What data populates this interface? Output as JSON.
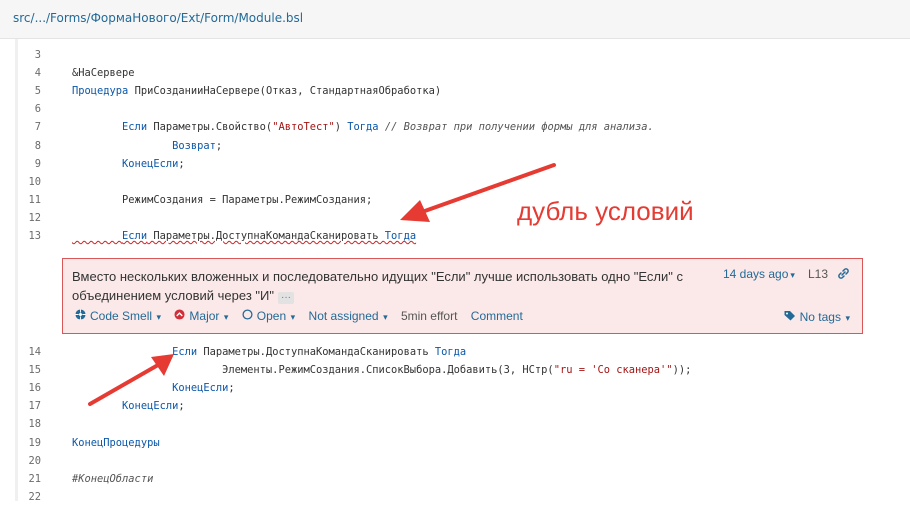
{
  "breadcrumb": {
    "path": "src/.../Forms/ФормаНового/Ext/Form/Module.bsl"
  },
  "code_top": [
    {
      "ln": "3"
    },
    {
      "ln": "4",
      "t": [
        {
          "x": "&НаСервере",
          "c": ""
        }
      ]
    },
    {
      "ln": "5",
      "t": [
        {
          "x": "Процедура",
          "c": "kw"
        },
        {
          "x": " ПриСозданииНаСервере(Отказ, СтандартнаяОбработка)",
          "c": ""
        }
      ]
    },
    {
      "ln": "6"
    },
    {
      "ln": "7",
      "t": [
        {
          "x": "        ",
          "c": ""
        },
        {
          "x": "Если",
          "c": "kw"
        },
        {
          "x": " Параметры.Свойство(",
          "c": ""
        },
        {
          "x": "\"АвтоТест\"",
          "c": "str"
        },
        {
          "x": ") ",
          "c": ""
        },
        {
          "x": "Тогда",
          "c": "kw"
        },
        {
          "x": " // Возврат при получении формы для анализа.",
          "c": "cm"
        }
      ]
    },
    {
      "ln": "8",
      "t": [
        {
          "x": "                ",
          "c": ""
        },
        {
          "x": "Возврат",
          "c": "kw"
        },
        {
          "x": ";",
          "c": ""
        }
      ]
    },
    {
      "ln": "9",
      "t": [
        {
          "x": "        ",
          "c": ""
        },
        {
          "x": "КонецЕсли",
          "c": "kw"
        },
        {
          "x": ";",
          "c": ""
        }
      ]
    },
    {
      "ln": "10"
    },
    {
      "ln": "11",
      "t": [
        {
          "x": "        РежимСоздания = Параметры.РежимСоздания;",
          "c": ""
        }
      ]
    },
    {
      "ln": "12"
    },
    {
      "ln": "13",
      "sq": true,
      "t": [
        {
          "x": "        ",
          "c": ""
        },
        {
          "x": "Если",
          "c": "kw"
        },
        {
          "x": " Параметры.ДоступнаКомандаСканировать ",
          "c": ""
        },
        {
          "x": "Тогда",
          "c": "kw"
        }
      ]
    }
  ],
  "code_bottom": [
    {
      "ln": "14",
      "t": [
        {
          "x": "                ",
          "c": ""
        },
        {
          "x": "Если",
          "c": "kw"
        },
        {
          "x": " Параметры.ДоступнаКомандаСканировать ",
          "c": ""
        },
        {
          "x": "Тогда",
          "c": "kw"
        }
      ]
    },
    {
      "ln": "15",
      "t": [
        {
          "x": "                        Элементы.РежимСоздания.СписокВыбора.Добавить(3, НСтр(",
          "c": ""
        },
        {
          "x": "\"ru = 'Со сканера'\"",
          "c": "str"
        },
        {
          "x": "));",
          "c": ""
        }
      ]
    },
    {
      "ln": "16",
      "t": [
        {
          "x": "                ",
          "c": ""
        },
        {
          "x": "КонецЕсли",
          "c": "kw"
        },
        {
          "x": ";",
          "c": ""
        }
      ]
    },
    {
      "ln": "17",
      "t": [
        {
          "x": "        ",
          "c": ""
        },
        {
          "x": "КонецЕсли",
          "c": "kw"
        },
        {
          "x": ";",
          "c": ""
        }
      ]
    },
    {
      "ln": "18"
    },
    {
      "ln": "19",
      "t": [
        {
          "x": "КонецПроцедуры",
          "c": "kw"
        }
      ]
    },
    {
      "ln": "20"
    },
    {
      "ln": "21",
      "t": [
        {
          "x": "#КонецОбласти",
          "c": "cm"
        }
      ]
    },
    {
      "ln": "22"
    }
  ],
  "issue": {
    "message": "Вместо нескольких вложенных и последовательно идущих \"Если\" лучше использовать одно \"Если\" с объединением условий через \"И\"",
    "more": "···",
    "age": "14 days ago",
    "line": "L13",
    "type": "Code Smell",
    "severity": "Major",
    "status": "Open",
    "assignee": "Not assigned",
    "effort": "5min effort",
    "comment": "Comment",
    "tags": "No tags"
  },
  "annotation": {
    "text": "дубль условий",
    "color": "#e53b33"
  }
}
